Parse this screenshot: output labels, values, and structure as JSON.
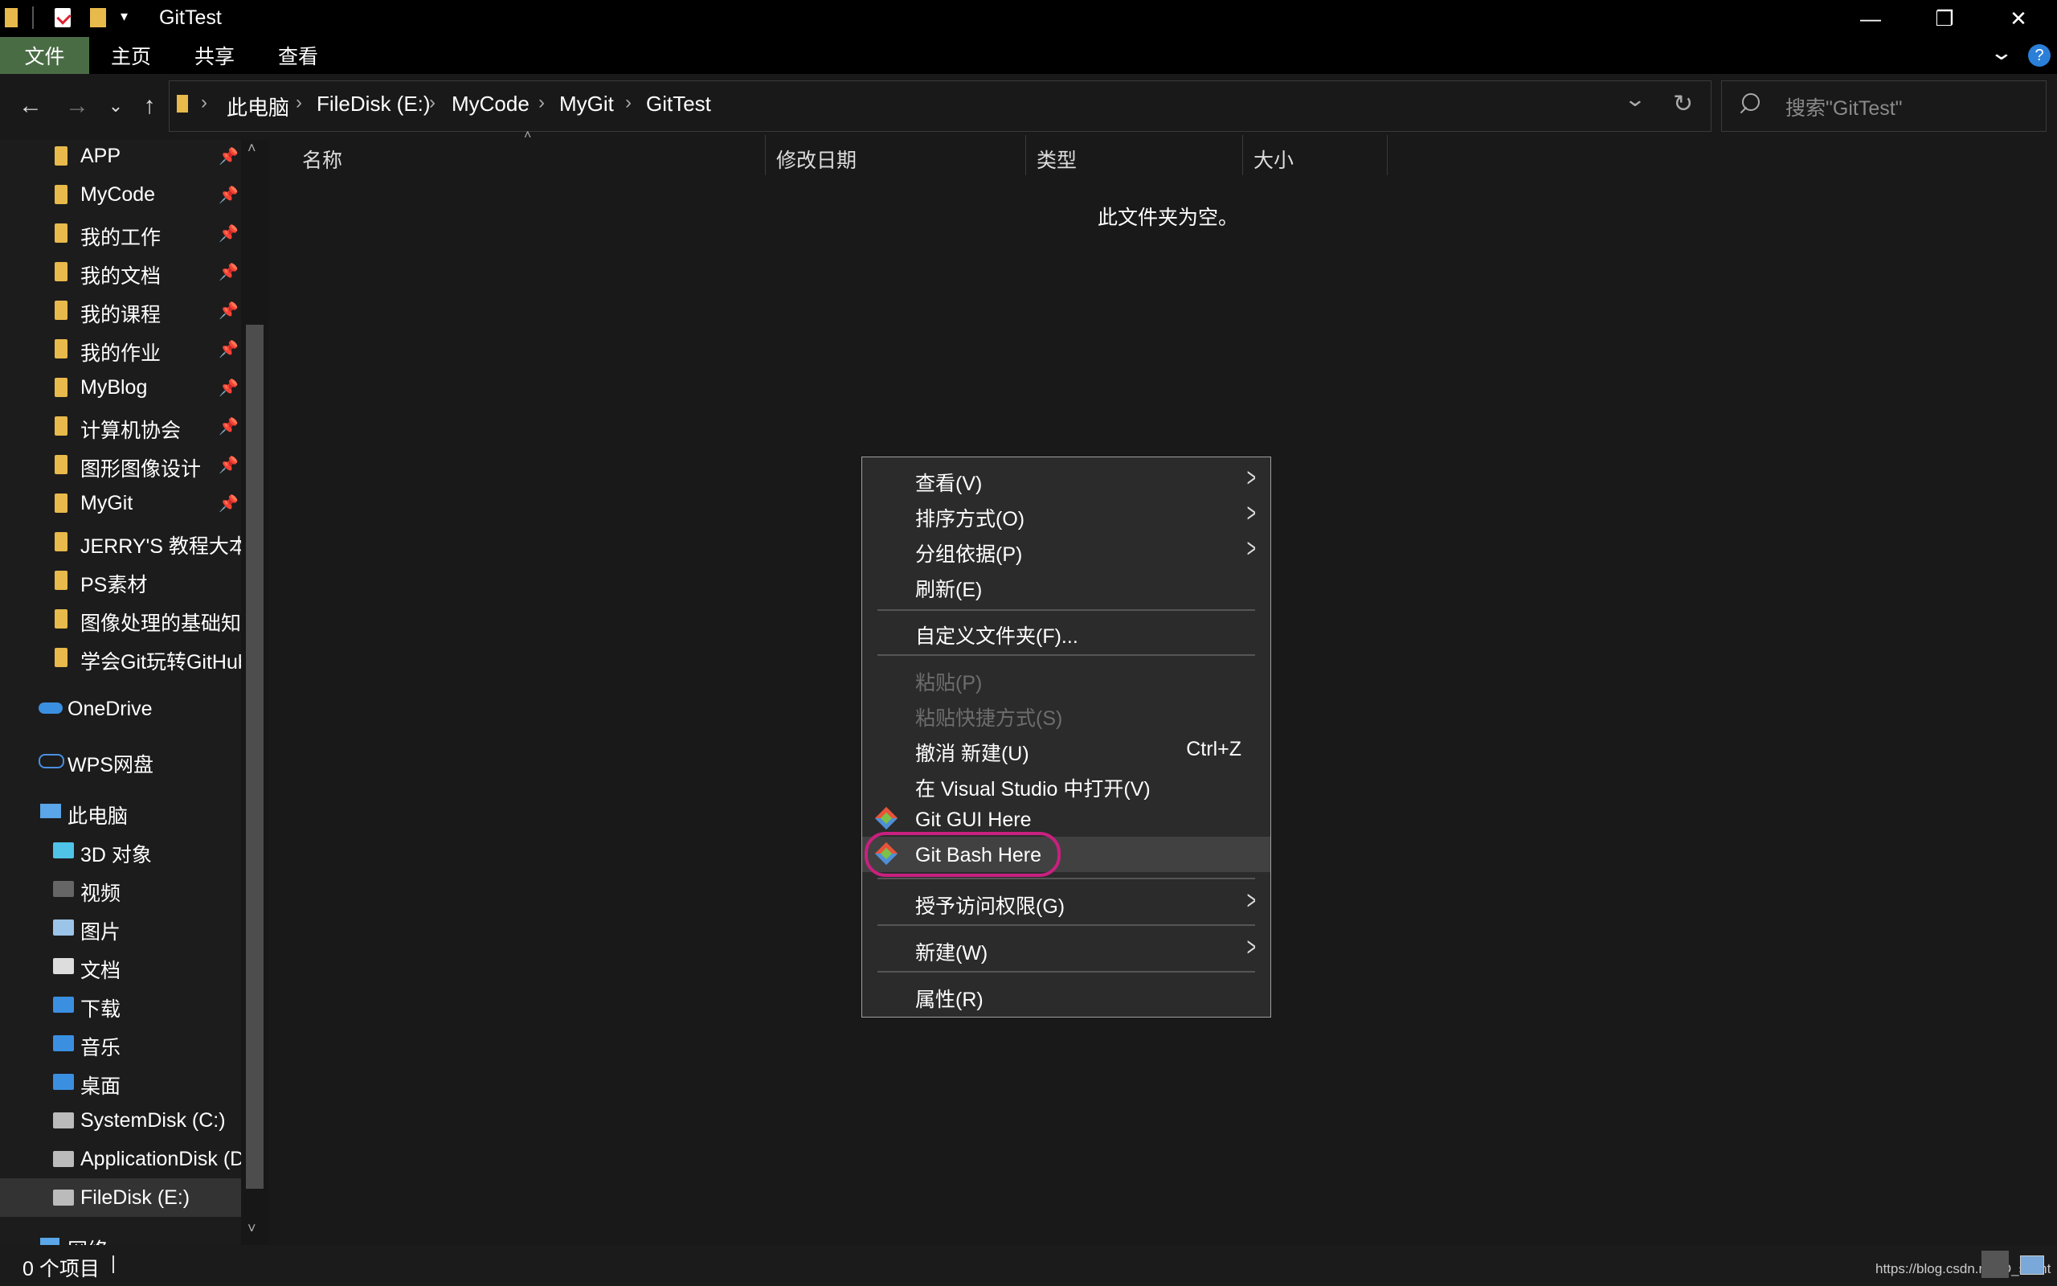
{
  "window": {
    "title": "GitTest",
    "controls": {
      "minimize": "—",
      "maximize": "❐",
      "close": "✕"
    }
  },
  "ribbon": {
    "tabs": [
      "文件",
      "主页",
      "共享",
      "查看"
    ],
    "help": "?"
  },
  "address_bar": {
    "breadcrumbs": [
      "此电脑",
      "FileDisk (E:)",
      "MyCode",
      "MyGit",
      "GitTest"
    ],
    "search_placeholder": "搜索\"GitTest\""
  },
  "sidebar": {
    "quick_access": [
      {
        "label": "APP",
        "pinned": true
      },
      {
        "label": "MyCode",
        "pinned": true
      },
      {
        "label": "我的工作",
        "pinned": true
      },
      {
        "label": "我的文档",
        "pinned": true
      },
      {
        "label": "我的课程",
        "pinned": true
      },
      {
        "label": "我的作业",
        "pinned": true
      },
      {
        "label": "MyBlog",
        "pinned": true
      },
      {
        "label": "计算机协会",
        "pinned": true
      },
      {
        "label": "图形图像设计",
        "pinned": true
      },
      {
        "label": "MyGit",
        "pinned": true
      },
      {
        "label": "JERRY'S 教程大本营",
        "pinned": false
      },
      {
        "label": "PS素材",
        "pinned": false
      },
      {
        "label": "图像处理的基础知识",
        "pinned": false
      },
      {
        "label": "学会Git玩转GitHub",
        "pinned": false
      }
    ],
    "onedrive": "OneDrive",
    "wps": "WPS网盘",
    "this_pc": "此电脑",
    "pc_items": [
      {
        "label": "3D 对象",
        "icon": "cube-icon"
      },
      {
        "label": "视频",
        "icon": "video-icon"
      },
      {
        "label": "图片",
        "icon": "picture-icon"
      },
      {
        "label": "文档",
        "icon": "document-icon"
      },
      {
        "label": "下载",
        "icon": "download-icon"
      },
      {
        "label": "音乐",
        "icon": "music-icon"
      },
      {
        "label": "桌面",
        "icon": "desktop-icon"
      },
      {
        "label": "SystemDisk (C:)",
        "icon": "drive-icon"
      },
      {
        "label": "ApplicationDisk (D:)",
        "icon": "drive-icon"
      },
      {
        "label": "FileDisk (E:)",
        "icon": "drive-icon",
        "selected": true
      }
    ],
    "network": "网络"
  },
  "columns": [
    "名称",
    "修改日期",
    "类型",
    "大小"
  ],
  "empty_message": "此文件夹为空。",
  "context_menu": {
    "items": [
      {
        "label": "查看(V)",
        "submenu": true
      },
      {
        "label": "排序方式(O)",
        "submenu": true
      },
      {
        "label": "分组依据(P)",
        "submenu": true
      },
      {
        "label": "刷新(E)"
      },
      {
        "label": "自定义文件夹(F)..."
      },
      {
        "label": "粘贴(P)",
        "disabled": true
      },
      {
        "label": "粘贴快捷方式(S)",
        "disabled": true
      },
      {
        "label": "撤消 新建(U)",
        "shortcut": "Ctrl+Z"
      },
      {
        "label": "在 Visual Studio 中打开(V)"
      },
      {
        "label": "Git GUI Here",
        "icon": "git-icon"
      },
      {
        "label": "Git Bash Here",
        "icon": "git-icon",
        "highlighted": true
      },
      {
        "label": "授予访问权限(G)",
        "submenu": true
      },
      {
        "label": "新建(W)",
        "submenu": true
      },
      {
        "label": "属性(R)"
      }
    ]
  },
  "status_bar": {
    "item_count": "0 个项目",
    "watermark": "https://blog.csdn.net/D_slient"
  },
  "colors": {
    "accent_file_tab": "#4a6c45",
    "highlight_circle": "#c8207f",
    "folder": "#e8b94b"
  }
}
